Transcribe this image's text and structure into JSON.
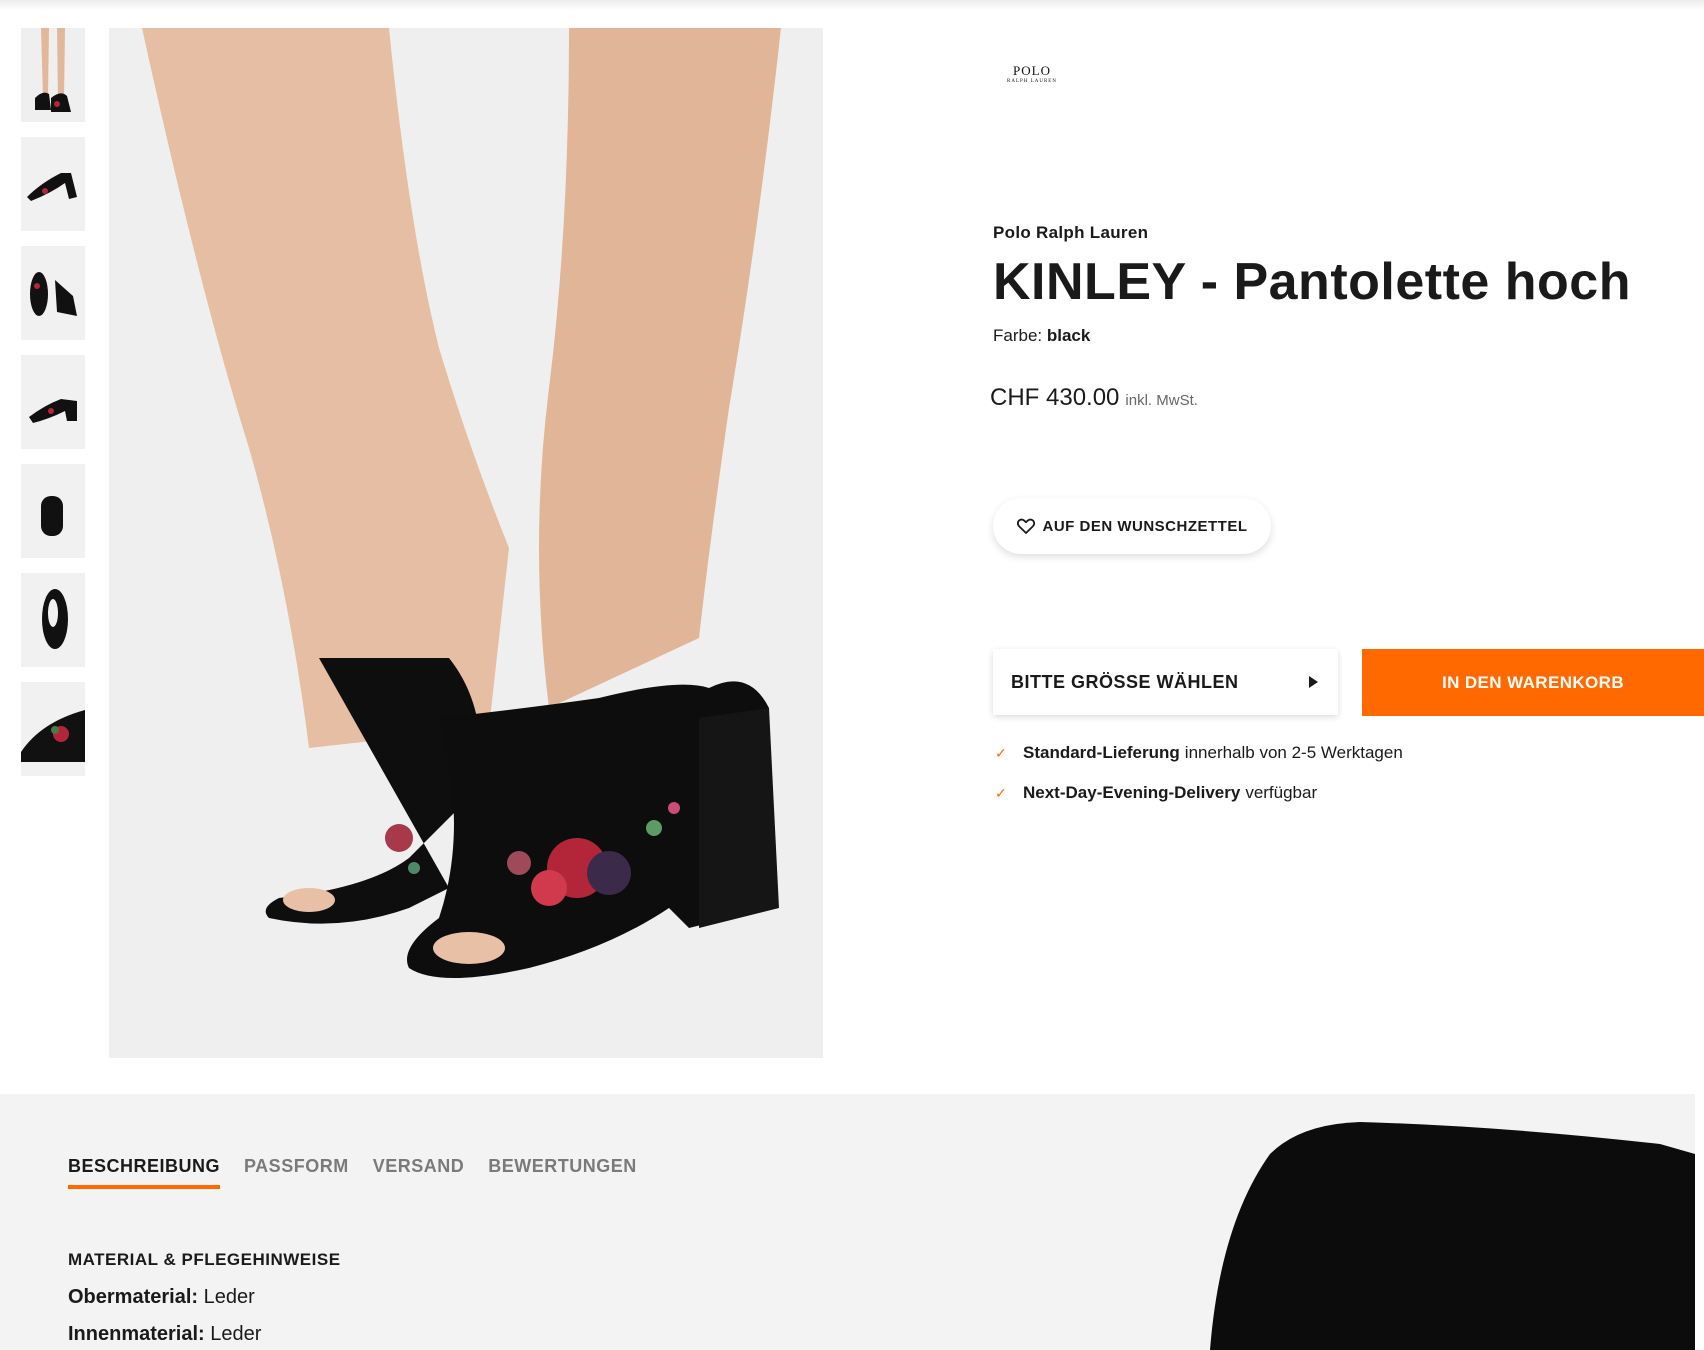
{
  "gallery": {
    "thumbnails": [
      {
        "label": "thumbnail-1",
        "active": true
      },
      {
        "label": "thumbnail-2",
        "active": false
      },
      {
        "label": "thumbnail-3",
        "active": false
      },
      {
        "label": "thumbnail-4",
        "active": false
      },
      {
        "label": "thumbnail-5",
        "active": false
      },
      {
        "label": "thumbnail-6",
        "active": false
      },
      {
        "label": "thumbnail-7",
        "active": false
      }
    ]
  },
  "product": {
    "logo_line1": "POLO",
    "logo_line2": "RALPH LAUREN",
    "brand": "Polo Ralph Lauren",
    "title": "KINLEY - Pantolette hoch",
    "color_label": "Farbe:",
    "color_value": "black",
    "price": "CHF 430.00",
    "vat_note": "inkl. MwSt."
  },
  "actions": {
    "wishlist_label": "AUF DEN WUNSCHZETTEL",
    "size_select_label": "BITTE GRÖSSE WÄHLEN",
    "add_to_cart_label": "IN DEN WARENKORB"
  },
  "delivery": [
    {
      "bold": "Standard-Lieferung",
      "text": "innerhalb von 2-5 Werktagen"
    },
    {
      "bold": "Next-Day-Evening-Delivery",
      "text": "verfügbar"
    }
  ],
  "details": {
    "tabs": [
      "BESCHREIBUNG",
      "PASSFORM",
      "VERSAND",
      "BEWERTUNGEN"
    ],
    "active_tab": "BESCHREIBUNG",
    "section_heading": "MATERIAL & PFLEGEHINWEISE",
    "attributes": [
      {
        "key": "Obermaterial:",
        "value": "Leder"
      },
      {
        "key": "Innenmaterial:",
        "value": "Leder"
      }
    ]
  },
  "colors": {
    "accent": "#ff6900",
    "text": "#1a1a1a",
    "muted": "#7a7a7a",
    "image_bg": "#efefef",
    "section_bg": "#f3f3f3"
  }
}
